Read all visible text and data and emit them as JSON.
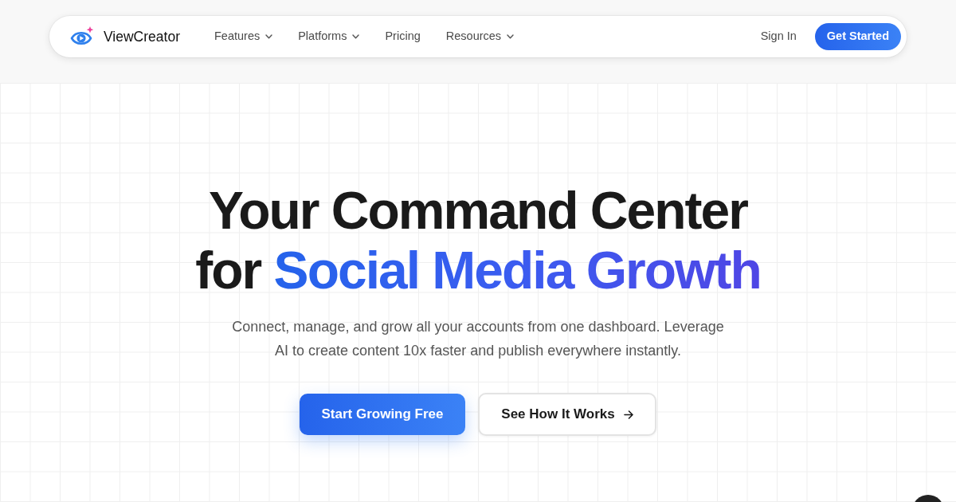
{
  "brand": {
    "name": "ViewCreator"
  },
  "nav": {
    "items": [
      {
        "label": "Features",
        "dropdown": true
      },
      {
        "label": "Platforms",
        "dropdown": true
      },
      {
        "label": "Pricing",
        "dropdown": false
      },
      {
        "label": "Resources",
        "dropdown": true
      }
    ],
    "sign_in": "Sign In",
    "cta": "Get Started"
  },
  "hero": {
    "headline": "Your Command Center for",
    "highlight": "Social Media Growth",
    "subtitle": "Connect, manage, and grow all your accounts from one dashboard. Leverage AI to create content 10x faster and publish everywhere instantly.",
    "buttons": [
      {
        "label": "Start Growing Free",
        "kind": "primary",
        "arrow": false
      },
      {
        "label": "See How It Works",
        "kind": "secondary",
        "arrow": true
      }
    ]
  }
}
